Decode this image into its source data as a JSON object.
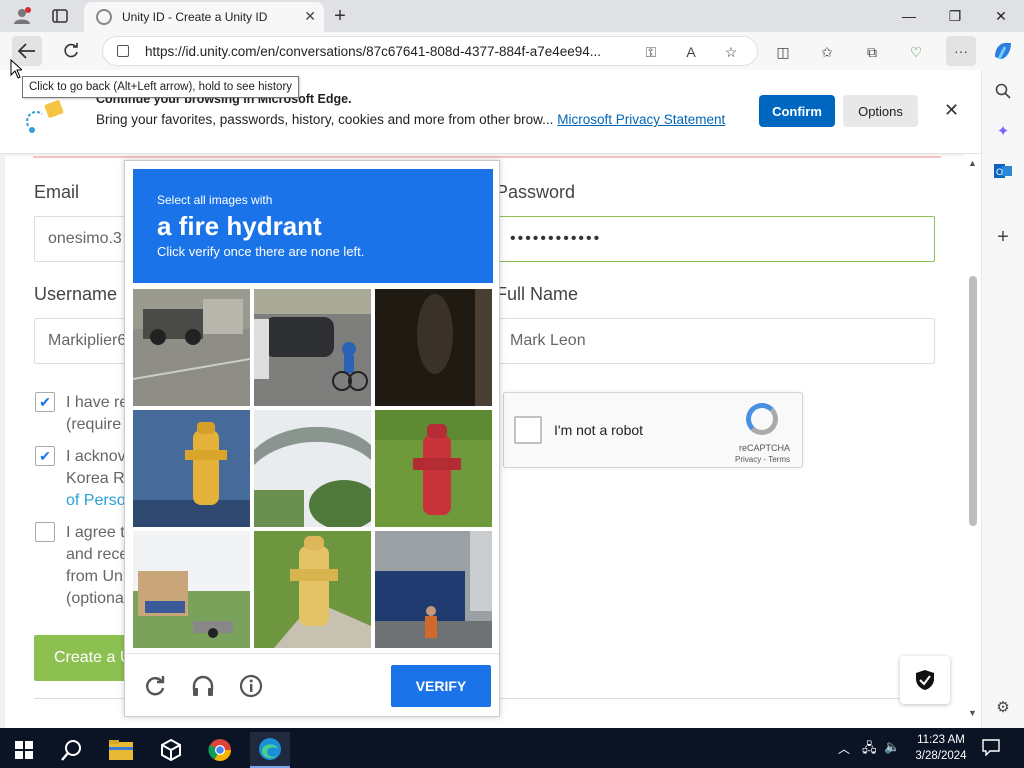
{
  "browser": {
    "tab_title": "Unity ID - Create a Unity ID",
    "url": "https://id.unity.com/en/conversations/87c67641-808d-4377-884f-a7e4ee94...",
    "back_tooltip": "Click to go back (Alt+Left arrow), hold to see history"
  },
  "infobar": {
    "title": "Continue your browsing in Microsoft Edge.",
    "message": "Bring your favorites, passwords, history, cookies and more from other brow...",
    "privacy_link": "Microsoft Privacy Statement",
    "confirm_label": "Confirm",
    "options_label": "Options"
  },
  "form": {
    "email_label": "Email",
    "email_value": "onesimo.3",
    "password_label": "Password",
    "password_value": "••••••••••••",
    "username_label": "Username",
    "username_value": "Markiplier6",
    "fullname_label": "Full Name",
    "fullname_value": "Mark Leon",
    "checkbox1_line1": "I have re",
    "checkbox1_line2": "(require",
    "checkbox2_line1": "I acknov",
    "checkbox2_line2": "Korea R",
    "checkbox2_line3": "of Perso",
    "checkbox3_line1": "I agree t",
    "checkbox3_line2": "and rece",
    "checkbox3_line3": "from Un",
    "checkbox3_line4": "(optiona",
    "create_label": "Create a U"
  },
  "recaptcha": {
    "checkbox_label": "I'm not a robot",
    "brand": "reCAPTCHA",
    "privacy_terms": "Privacy - Terms"
  },
  "challenge": {
    "line1": "Select all images with",
    "target": "a fire hydrant",
    "line3": "Click verify once there are none left.",
    "verify_label": "VERIFY",
    "tiles": [
      "street-scooter",
      "cyclist-car",
      "dark-shadow",
      "yellow-hydrant",
      "overpass",
      "red-hydrant",
      "building-field",
      "yellow-hydrant-grass",
      "street-person"
    ]
  },
  "taskbar": {
    "time": "11:23 AM",
    "date": "3/28/2024"
  }
}
